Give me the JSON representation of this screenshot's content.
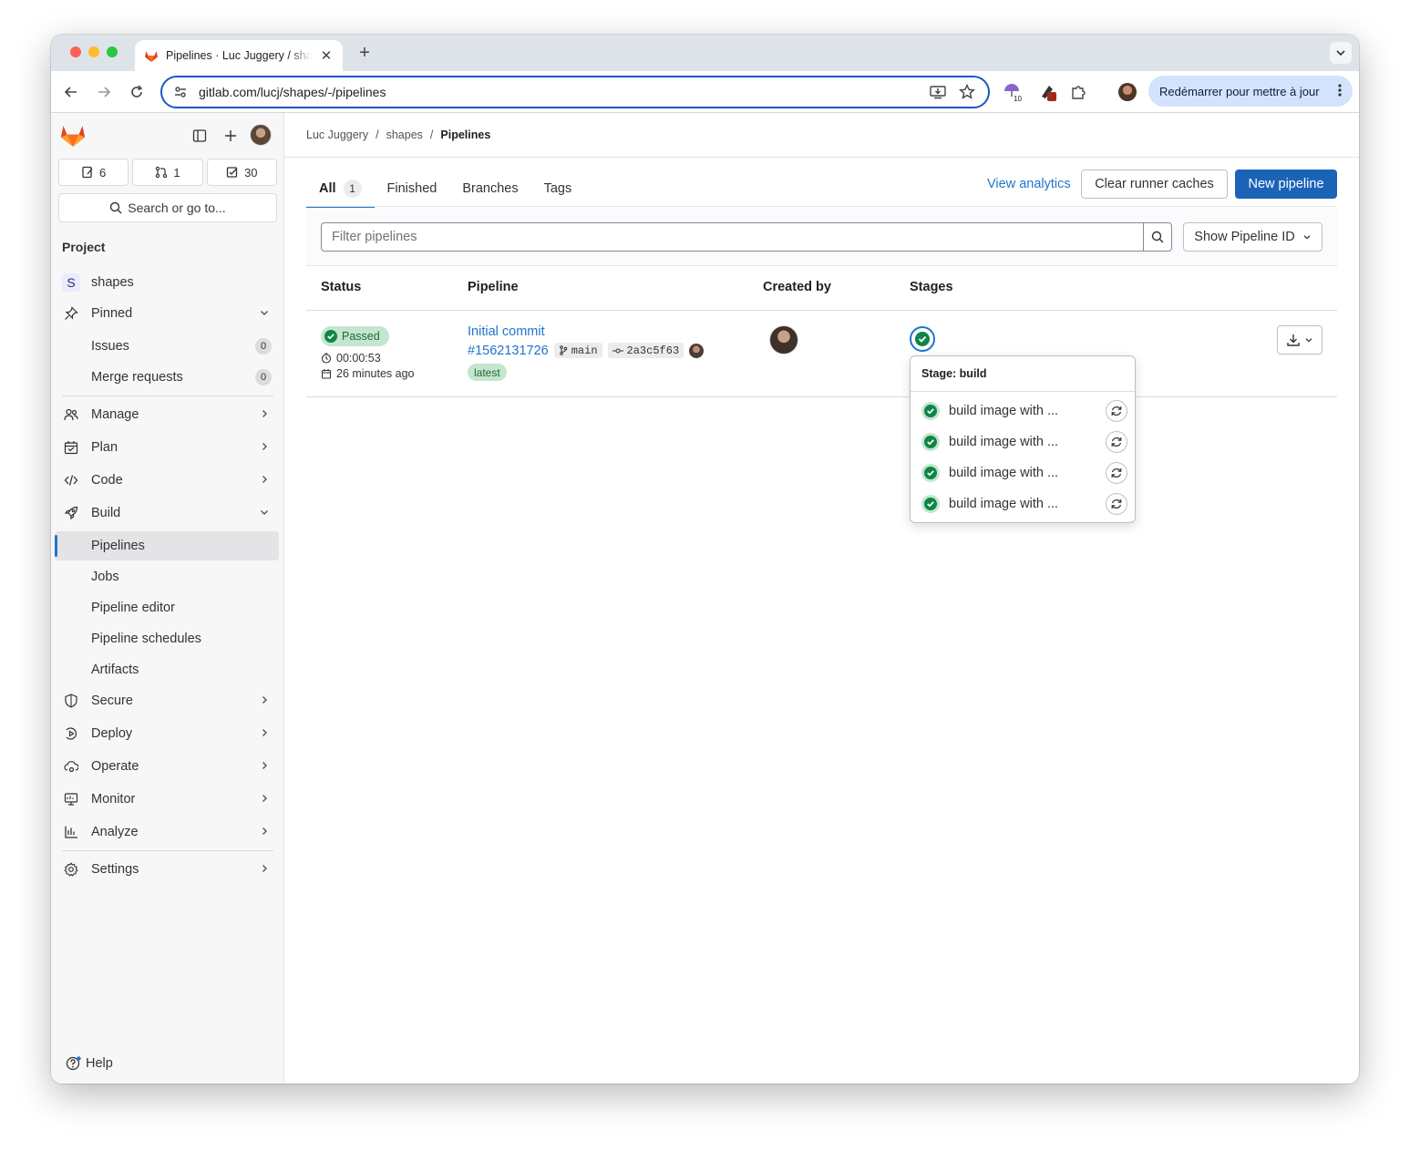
{
  "browser": {
    "tab_title": "Pipelines · Luc Juggery / shapes",
    "url": "gitlab.com/lucj/shapes/-/pipelines",
    "restart_label": "Redémarrer pour mettre à jour",
    "extension_badge": "10"
  },
  "sidebar": {
    "counters": {
      "issues": "6",
      "merge_requests": "1",
      "todos": "30"
    },
    "search_label": "Search or go to...",
    "section_title": "Project",
    "project": {
      "initial": "S",
      "name": "shapes"
    },
    "pinned_label": "Pinned",
    "pinned_items": [
      {
        "label": "Issues",
        "count": "0"
      },
      {
        "label": "Merge requests",
        "count": "0"
      }
    ],
    "nav": {
      "manage": "Manage",
      "plan": "Plan",
      "code": "Code",
      "build": "Build",
      "secure": "Secure",
      "deploy": "Deploy",
      "operate": "Operate",
      "monitor": "Monitor",
      "analyze": "Analyze",
      "settings": "Settings"
    },
    "build_items": [
      "Pipelines",
      "Jobs",
      "Pipeline editor",
      "Pipeline schedules",
      "Artifacts"
    ],
    "help_label": "Help"
  },
  "breadcrumb": [
    "Luc Juggery",
    "shapes",
    "Pipelines"
  ],
  "tabs": [
    {
      "label": "All",
      "count": "1"
    },
    {
      "label": "Finished"
    },
    {
      "label": "Branches"
    },
    {
      "label": "Tags"
    }
  ],
  "actions": {
    "analytics": "View analytics",
    "clear_caches": "Clear runner caches",
    "new_pipeline": "New pipeline"
  },
  "filter": {
    "placeholder": "Filter pipelines",
    "show_id_label": "Show Pipeline ID"
  },
  "table": {
    "headers": [
      "Status",
      "Pipeline",
      "Created by",
      "Stages"
    ],
    "row": {
      "status": "Passed",
      "duration": "00:00:53",
      "created": "26 minutes ago",
      "title": "Initial commit",
      "pipeline_id": "#1562131726",
      "branch": "main",
      "commit": "2a3c5f63",
      "label": "latest"
    }
  },
  "stage_popover": {
    "title": "Stage: build",
    "jobs": [
      "build image with ...",
      "build image with ...",
      "build image with ...",
      "build image with ..."
    ]
  },
  "colors": {
    "accent": "#1f75cb",
    "success": "#108548",
    "success_bg": "#c3e6cd"
  }
}
